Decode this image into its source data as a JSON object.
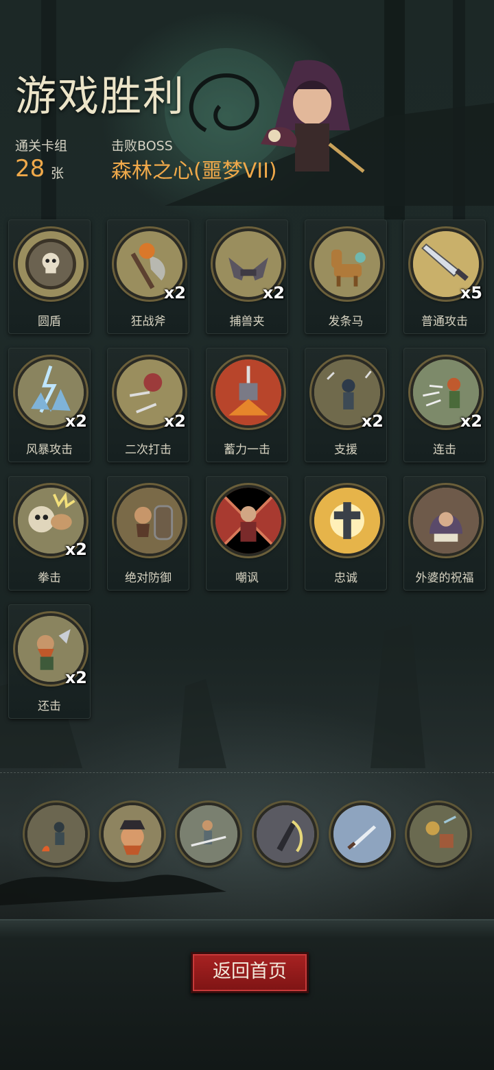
{
  "header": {
    "title": "游戏胜利",
    "deck_label": "通关卡组",
    "deck_count": "28",
    "deck_unit": "张",
    "boss_label": "击败BOSS",
    "boss_name": "森林之心(噩梦VII)"
  },
  "cards": [
    {
      "name": "圆盾",
      "qty": "",
      "icon": "round-shield-skull",
      "art": "#6b6250"
    },
    {
      "name": "狂战斧",
      "qty": "x2",
      "icon": "battle-axe",
      "art": "#5c5440"
    },
    {
      "name": "捕兽夹",
      "qty": "x2",
      "icon": "bear-trap",
      "art": "#5a5560"
    },
    {
      "name": "发条马",
      "qty": "",
      "icon": "clockwork-horse",
      "art": "#b07a3a"
    },
    {
      "name": "普通攻击",
      "qty": "x5",
      "icon": "sword-slash",
      "art": "#c9b06a"
    },
    {
      "name": "风暴攻击",
      "qty": "x2",
      "icon": "lightning-storm",
      "art": "#7fb3d8"
    },
    {
      "name": "二次打击",
      "qty": "x2",
      "icon": "double-strike",
      "art": "#8a7c5a"
    },
    {
      "name": "蓄力一击",
      "qty": "",
      "icon": "charged-hammer",
      "art": "#b8452b"
    },
    {
      "name": "支援",
      "qty": "x2",
      "icon": "support-warrior",
      "art": "#3d4a55"
    },
    {
      "name": "连击",
      "qty": "x2",
      "icon": "combo-archer",
      "art": "#7d8a6a"
    },
    {
      "name": "拳击",
      "qty": "x2",
      "icon": "punch-skull",
      "art": "#d8c8a0"
    },
    {
      "name": "绝对防御",
      "qty": "",
      "icon": "dwarf-shield",
      "art": "#6e5d48"
    },
    {
      "name": "嘲讽",
      "qty": "",
      "icon": "taunt-villain",
      "art": "#a83a30"
    },
    {
      "name": "忠诚",
      "qty": "",
      "icon": "holy-cross",
      "art": "#e6b44a"
    },
    {
      "name": "外婆的祝福",
      "qty": "",
      "icon": "grandma-book",
      "art": "#5a4a6a"
    },
    {
      "name": "还击",
      "qty": "x2",
      "icon": "counter-dwarf",
      "art": "#8a6a4a"
    }
  ],
  "relics": [
    {
      "icon": "campfire-warrior-icon",
      "art": "#5c5a48"
    },
    {
      "icon": "pirate-dwarf-icon",
      "art": "#a9684a"
    },
    {
      "icon": "sword-dancer-icon",
      "art": "#7a8070"
    },
    {
      "icon": "crescent-blade-icon",
      "art": "#4a4a55"
    },
    {
      "icon": "throwing-knife-icon",
      "art": "#8ea4bf"
    },
    {
      "icon": "mechanical-trinket-icon",
      "art": "#6a6a50"
    }
  ],
  "footer": {
    "home_label": "返回首页"
  }
}
